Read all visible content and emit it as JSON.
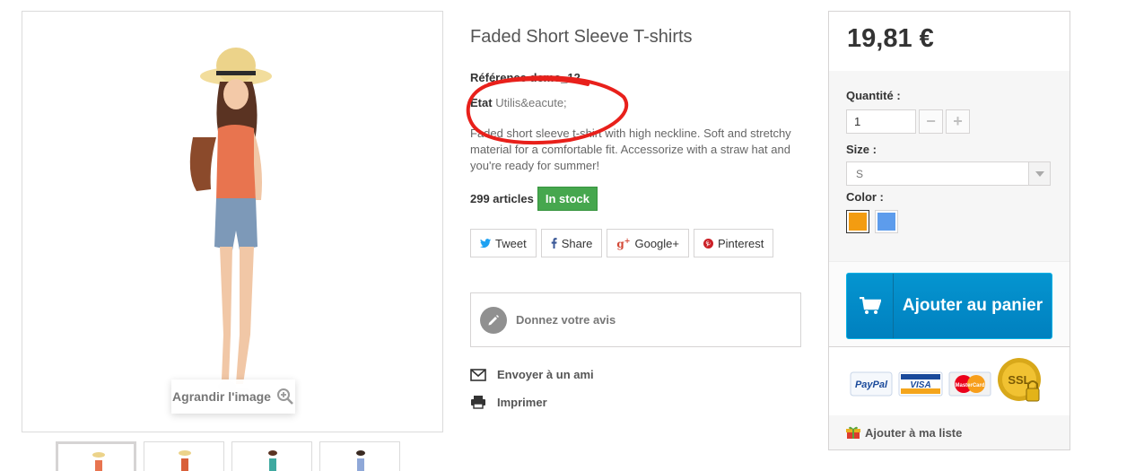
{
  "product": {
    "title": "Faded Short Sleeve T-shirts",
    "reference_label": "Référence",
    "reference_value": "demo_12",
    "condition_label": "Etat",
    "condition_value": "Utilis&eacute;",
    "description": "Faded short sleeve t-shirt with high neckline. Soft and stretchy material for a comfortable fit. Accessorize with a straw hat and you're ready for summer!",
    "quantity_available": "299 articles",
    "stock_status": "In stock"
  },
  "image": {
    "zoom_label": "Agrandir l'image"
  },
  "social": [
    {
      "label": "Tweet",
      "icon": "twitter-icon",
      "color": "#1da1f2"
    },
    {
      "label": "Share",
      "icon": "facebook-icon",
      "color": "#3b5998"
    },
    {
      "label": "Google+",
      "icon": "google-plus-icon",
      "color": "#d34836"
    },
    {
      "label": "Pinterest",
      "icon": "pinterest-icon",
      "color": "#cb2027"
    }
  ],
  "review": {
    "label": "Donnez votre avis"
  },
  "links": {
    "send_friend": "Envoyer à un ami",
    "print": "Imprimer"
  },
  "buy_box": {
    "price": "19,81 €",
    "quantity_label": "Quantité :",
    "quantity_value": "1",
    "size_label": "Size :",
    "size_value": "S",
    "color_label": "Color :",
    "colors": [
      "#f39c11",
      "#5d9cec"
    ],
    "add_to_cart": "Ajouter au panier",
    "wishlist": "Ajouter à ma liste",
    "payment_logos": [
      "PayPal",
      "VISA",
      "MasterCard",
      "SSL"
    ]
  },
  "colors": {
    "stock_green": "#46a74e",
    "cart_blue": "#0595d0",
    "annotation_red": "#e8201b"
  }
}
